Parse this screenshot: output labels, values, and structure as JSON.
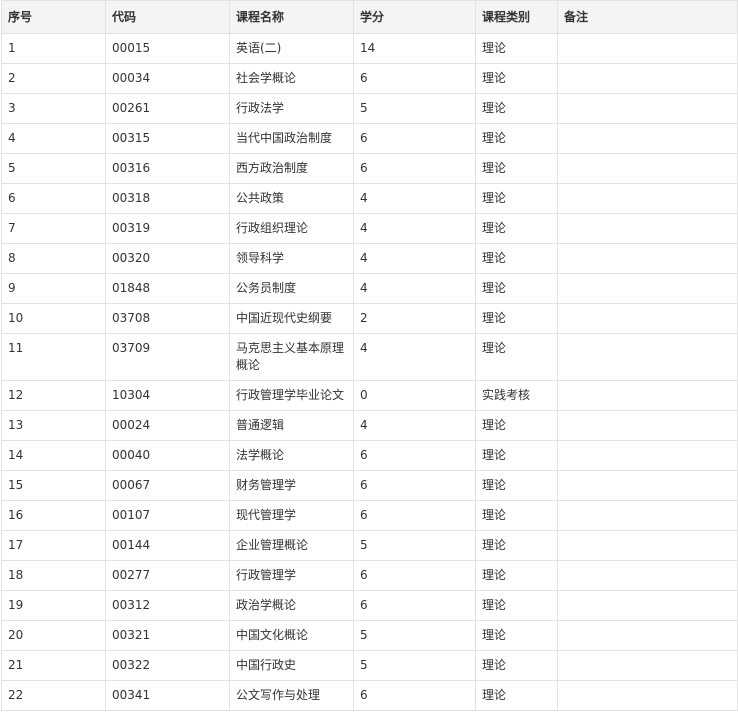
{
  "table": {
    "headers": [
      "序号",
      "代码",
      "课程名称",
      "学分",
      "课程类别",
      "备注"
    ],
    "rows": [
      [
        "1",
        "00015",
        "英语(二)",
        "14",
        "理论",
        ""
      ],
      [
        "2",
        "00034",
        "社会学概论",
        "6",
        "理论",
        ""
      ],
      [
        "3",
        "00261",
        "行政法学",
        "5",
        "理论",
        ""
      ],
      [
        "4",
        "00315",
        "当代中国政治制度",
        "6",
        "理论",
        ""
      ],
      [
        "5",
        "00316",
        "西方政治制度",
        "6",
        "理论",
        ""
      ],
      [
        "6",
        "00318",
        "公共政策",
        "4",
        "理论",
        ""
      ],
      [
        "7",
        "00319",
        "行政组织理论",
        "4",
        "理论",
        ""
      ],
      [
        "8",
        "00320",
        "领导科学",
        "4",
        "理论",
        ""
      ],
      [
        "9",
        "01848",
        "公务员制度",
        "4",
        "理论",
        ""
      ],
      [
        "10",
        "03708",
        "中国近现代史纲要",
        "2",
        "理论",
        ""
      ],
      [
        "11",
        "03709",
        "马克思主义基本原理概论",
        "4",
        "理论",
        ""
      ],
      [
        "12",
        "10304",
        "行政管理学毕业论文",
        "0",
        "实践考核",
        ""
      ],
      [
        "13",
        "00024",
        "普通逻辑",
        "4",
        "理论",
        ""
      ],
      [
        "14",
        "00040",
        "法学概论",
        "6",
        "理论",
        ""
      ],
      [
        "15",
        "00067",
        "财务管理学",
        "6",
        "理论",
        ""
      ],
      [
        "16",
        "00107",
        "现代管理学",
        "6",
        "理论",
        ""
      ],
      [
        "17",
        "00144",
        "企业管理概论",
        "5",
        "理论",
        ""
      ],
      [
        "18",
        "00277",
        "行政管理学",
        "6",
        "理论",
        ""
      ],
      [
        "19",
        "00312",
        "政治学概论",
        "6",
        "理论",
        ""
      ],
      [
        "20",
        "00321",
        "中国文化概论",
        "5",
        "理论",
        ""
      ],
      [
        "21",
        "00322",
        "中国行政史",
        "5",
        "理论",
        ""
      ],
      [
        "22",
        "00341",
        "公文写作与处理",
        "6",
        "理论",
        ""
      ]
    ]
  }
}
